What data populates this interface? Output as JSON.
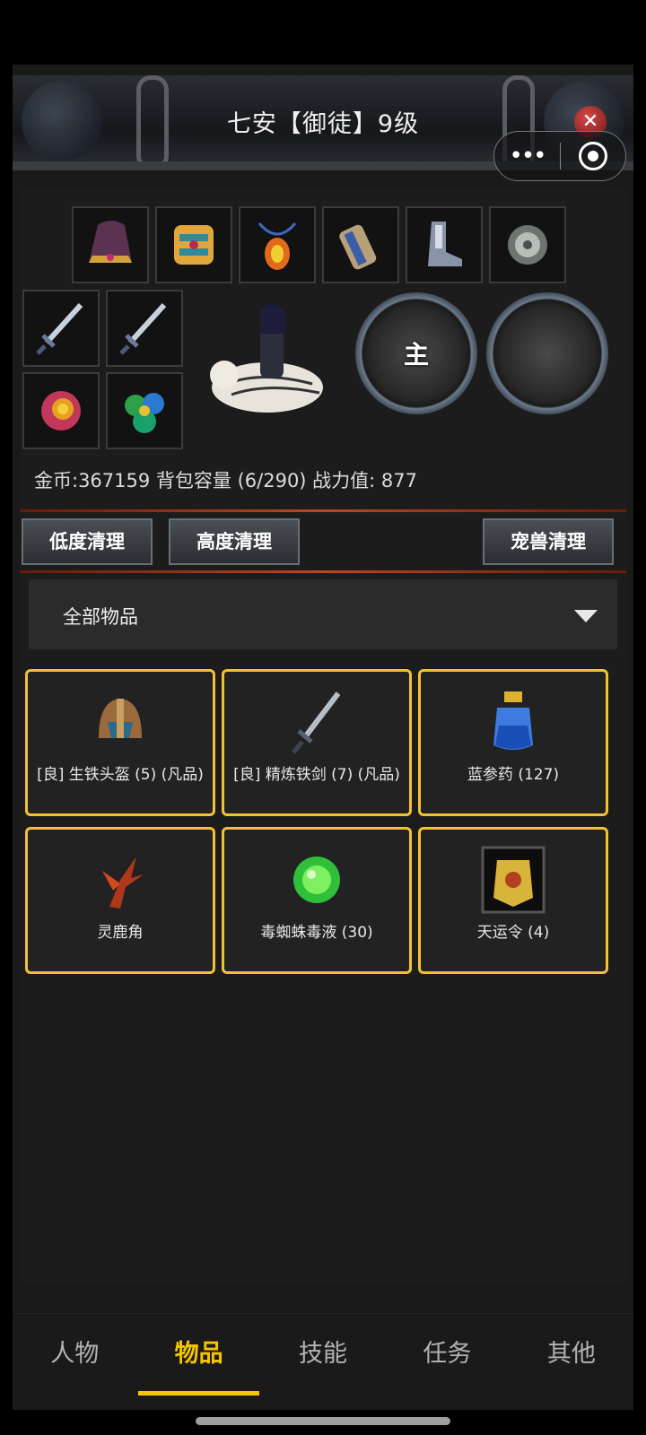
{
  "header": {
    "title": "七安【御徒】9级",
    "close_glyph": "✕"
  },
  "capsule": {
    "more_glyph": "•••"
  },
  "equipment": {
    "slots": [
      {
        "icon": "hat-icon"
      },
      {
        "icon": "armor-icon"
      },
      {
        "icon": "amulet-icon"
      },
      {
        "icon": "bracer-icon"
      },
      {
        "icon": "boots-icon"
      },
      {
        "icon": "jade-pendant-icon"
      },
      {
        "icon": "sword-icon"
      },
      {
        "icon": "sword-icon"
      },
      {
        "icon": "ring-icon"
      },
      {
        "icon": "gem-cluster-icon"
      }
    ],
    "pet_main_label": "主"
  },
  "stats": {
    "text": "金币:367159 背包容量 (6/290) 战力值: 877"
  },
  "actions": {
    "low_clean": "低度清理",
    "high_clean": "高度清理",
    "pet_clean": "宠兽清理"
  },
  "filter": {
    "selected": "全部物品"
  },
  "items": [
    {
      "name": "[良] 生铁头盔 (5) (凡品)",
      "icon": "helmet-icon"
    },
    {
      "name": "[良] 精炼铁剑 (7) (凡品)",
      "icon": "sword-icon"
    },
    {
      "name": "蓝参药 (127)",
      "icon": "potion-icon"
    },
    {
      "name": "灵鹿角",
      "icon": "antler-icon"
    },
    {
      "name": "毒蜘蛛毒液 (30)",
      "icon": "venom-icon"
    },
    {
      "name": "天运令 (4)",
      "icon": "token-icon"
    }
  ],
  "nav": {
    "tabs": [
      "人物",
      "物品",
      "技能",
      "任务",
      "其他"
    ],
    "active": "物品"
  },
  "colors": {
    "accent": "#f7c500",
    "item_border": "#f2c233",
    "background": "#1a1a1a"
  }
}
